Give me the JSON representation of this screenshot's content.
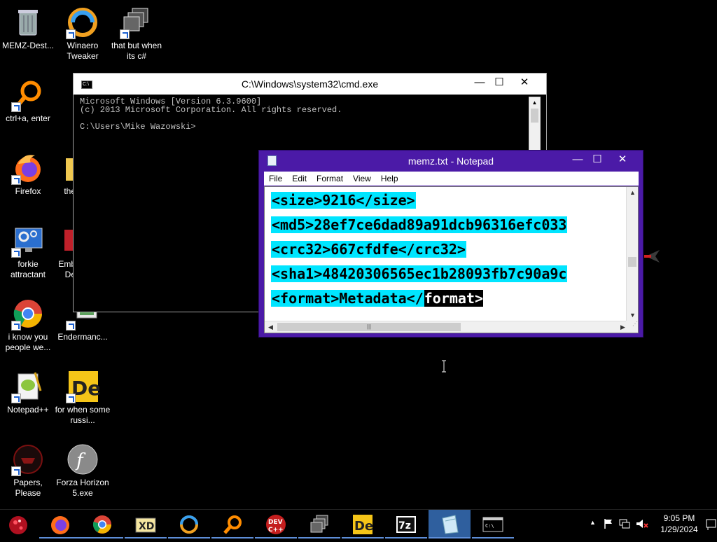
{
  "desktop_icons": [
    {
      "id": "recycle",
      "label": "MEMZ-Dest..."
    },
    {
      "id": "winaero",
      "label": "Winaero Tweaker"
    },
    {
      "id": "thatbut",
      "label": "that but when its c#"
    },
    {
      "id": "ctrla",
      "label": "ctrl+a, enter"
    },
    {
      "id": "firefox",
      "label": "Firefox"
    },
    {
      "id": "the",
      "label": "the"
    },
    {
      "id": "forkie",
      "label": "forkie attractant"
    },
    {
      "id": "emb",
      "label": "Emb De"
    },
    {
      "id": "iknow",
      "label": "i know you people we..."
    },
    {
      "id": "enderman",
      "label": "Endermanc..."
    },
    {
      "id": "notepadpp",
      "label": "Notepad++"
    },
    {
      "id": "forwhen",
      "label": "for when some russi..."
    },
    {
      "id": "papers",
      "label": "Papers, Please"
    },
    {
      "id": "forza",
      "label": "Forza Horizon 5.exe"
    }
  ],
  "cmd": {
    "title": "C:\\Windows\\system32\\cmd.exe",
    "lines": [
      "Microsoft Windows [Version 6.3.9600]",
      "(c) 2013 Microsoft Corporation. All rights reserved.",
      "",
      "C:\\Users\\Mike Wazowski>"
    ]
  },
  "notepad": {
    "title": "memz.txt - Notepad",
    "menu": [
      "File",
      "Edit",
      "Format",
      "View",
      "Help"
    ],
    "lines": [
      {
        "hl": "<size>9216</size>",
        "rest": ""
      },
      {
        "hl": "<md5>28ef7ce6dad89a91dcb96316efc033",
        "rest": ""
      },
      {
        "hl": "<crc32>667cfdfe</crc32>",
        "rest": ""
      },
      {
        "hl": "<sha1>48420306565ec1b28093fb7c90a9c",
        "rest": ""
      },
      {
        "hl": "<format>Metadata</",
        "rest": "format>"
      }
    ]
  },
  "taskbar": {
    "items": [
      "start",
      "firefox",
      "chrome",
      "xd",
      "winaero",
      "search",
      "devcpp",
      "tasks",
      "de",
      "7zip",
      "notepad",
      "cmd"
    ],
    "time": "9:05 PM",
    "date": "1/29/2024"
  },
  "colors": {
    "highlight": "#00e5ff",
    "notepad_frame": "#4b1aa7",
    "taskbar_active": "#5e8ed8"
  }
}
